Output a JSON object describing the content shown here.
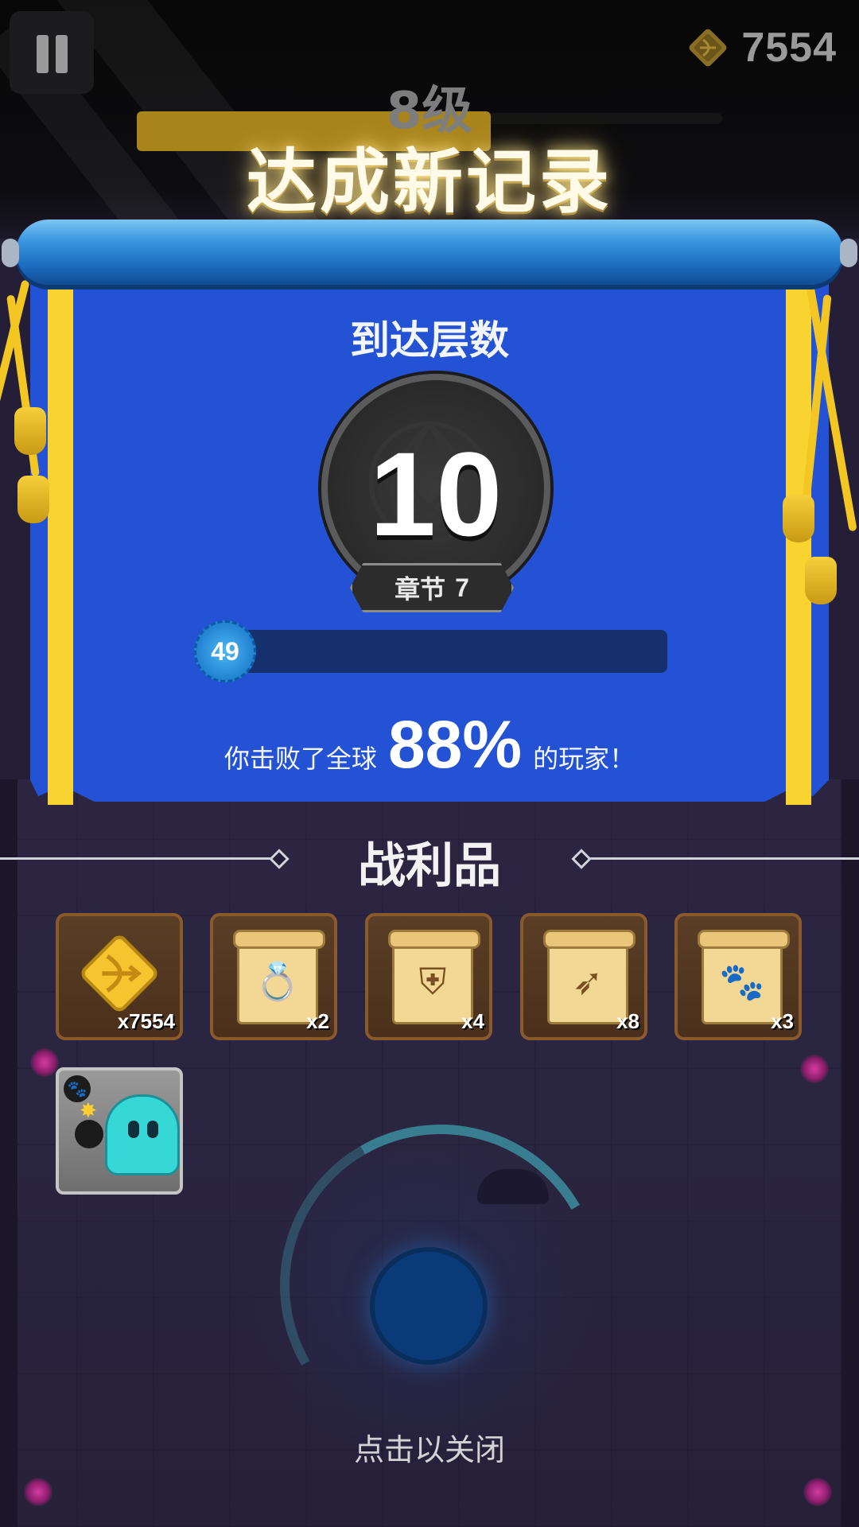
{
  "hud": {
    "coins": "7554",
    "level_label": "8级",
    "level_progress": 0.6
  },
  "banner": {
    "title": "达成新记录"
  },
  "result": {
    "floors_label": "到达层数",
    "floor_number": "10",
    "chapter_label": "章节",
    "chapter_number": "7",
    "player_level": "49",
    "defeat_prefix": "你击败了全球",
    "defeat_percent": "88%",
    "defeat_suffix": "的玩家！"
  },
  "loot": {
    "title": "战利品",
    "items": [
      {
        "icon": "coin-bow-icon",
        "quantity": "x7554"
      },
      {
        "icon": "ring-scroll-icon",
        "quantity": "x2"
      },
      {
        "icon": "armor-scroll-icon",
        "quantity": "x4"
      },
      {
        "icon": "bow-scroll-icon",
        "quantity": "x8"
      },
      {
        "icon": "paw-scroll-icon",
        "quantity": "x3"
      }
    ],
    "pet": {
      "icon": "ghost-bomb-pet-icon"
    }
  },
  "footer": {
    "close_hint": "点击以关闭"
  },
  "colors": {
    "panel_blue": "#2352d4",
    "panel_stripe": "#f9d430",
    "loot_slot": "#5a3e26",
    "background": "#241f36"
  }
}
